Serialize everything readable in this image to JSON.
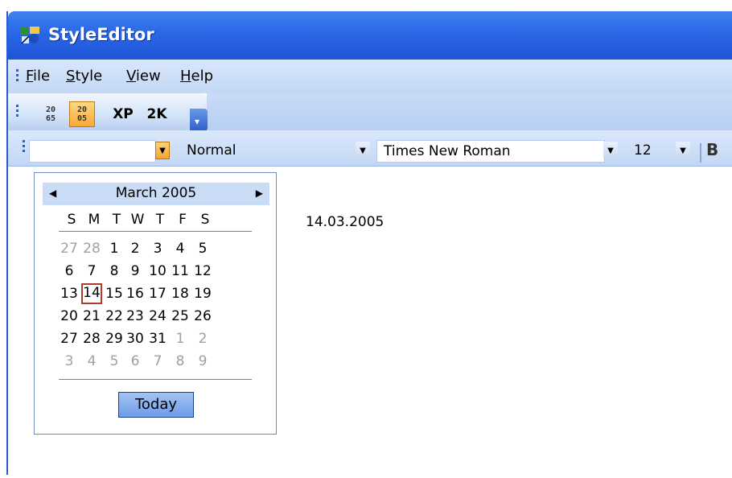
{
  "window": {
    "title": "StyleEditor",
    "app_icon": "styleeditor-icon"
  },
  "menu": {
    "items": [
      {
        "label": "File",
        "mnemonic": "F",
        "rest": "ile"
      },
      {
        "label": "Style",
        "mnemonic": "S",
        "rest": "tyle"
      },
      {
        "label": "View",
        "mnemonic": "V",
        "rest": "iew"
      },
      {
        "label": "Help",
        "mnemonic": "H",
        "rest": "elp"
      }
    ]
  },
  "style_toolbar": {
    "btn_office2003_top": "20",
    "btn_office2003_bottom": "65",
    "btn_office2005_top": "20",
    "btn_office2005_bottom": "05",
    "btn_xp": "XP",
    "btn_2k": "2K"
  },
  "format_toolbar": {
    "date_value": "",
    "style_value": "Normal",
    "font_value": "Times New Roman",
    "size_value": "12",
    "bold_label": "B"
  },
  "calendar": {
    "month_label": "March 2005",
    "days_of_week": [
      "S",
      "M",
      "T",
      "W",
      "T",
      "F",
      "S"
    ],
    "weeks": [
      [
        "27",
        "28",
        "1",
        "2",
        "3",
        "4",
        "5"
      ],
      [
        "6",
        "7",
        "8",
        "9",
        "10",
        "11",
        "12"
      ],
      [
        "13",
        "14",
        "15",
        "16",
        "17",
        "18",
        "19"
      ],
      [
        "20",
        "21",
        "22",
        "23",
        "24",
        "25",
        "26"
      ],
      [
        "27",
        "28",
        "29",
        "30",
        "31",
        "1",
        "2"
      ],
      [
        "3",
        "4",
        "5",
        "6",
        "7",
        "8",
        "9"
      ]
    ],
    "today_button": "Today"
  },
  "document": {
    "date_text": "14.03.2005"
  },
  "colors": {
    "title_blue": "#2a66e6",
    "toolbar_blue": "#c3d8f5",
    "selected_orange": "#f7a93a",
    "today_border": "#b23a2a"
  }
}
